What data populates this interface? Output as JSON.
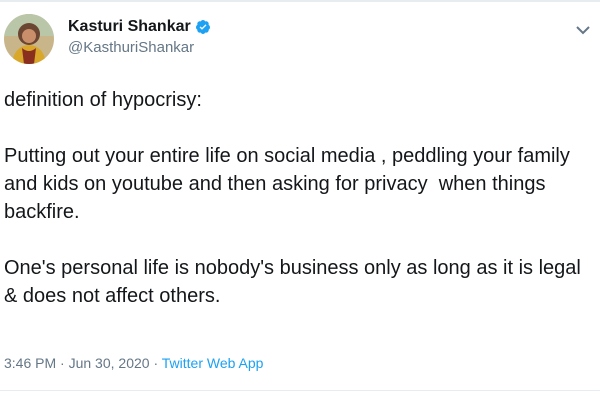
{
  "tweet": {
    "author": {
      "display_name": "Kasturi Shankar",
      "handle": "@KasthuriShankar",
      "verified": true,
      "avatar_icon": "user-avatar"
    },
    "text": {
      "line1": "definition of hypocrisy:",
      "paragraph2": "Putting out your entire life on social media , peddling your family and kids on youtube and then asking for privacy  when things backfire.",
      "paragraph3": "One's personal life is nobody's business only as long as it is legal & does not affect others."
    },
    "meta": {
      "time": "3:46 PM",
      "separator1": " · ",
      "date": "Jun 30, 2020",
      "separator2": " · ",
      "source": "Twitter Web App"
    },
    "colors": {
      "accent": "#1da1f2",
      "secondary_text": "#657786",
      "primary_text": "#14171a"
    }
  }
}
